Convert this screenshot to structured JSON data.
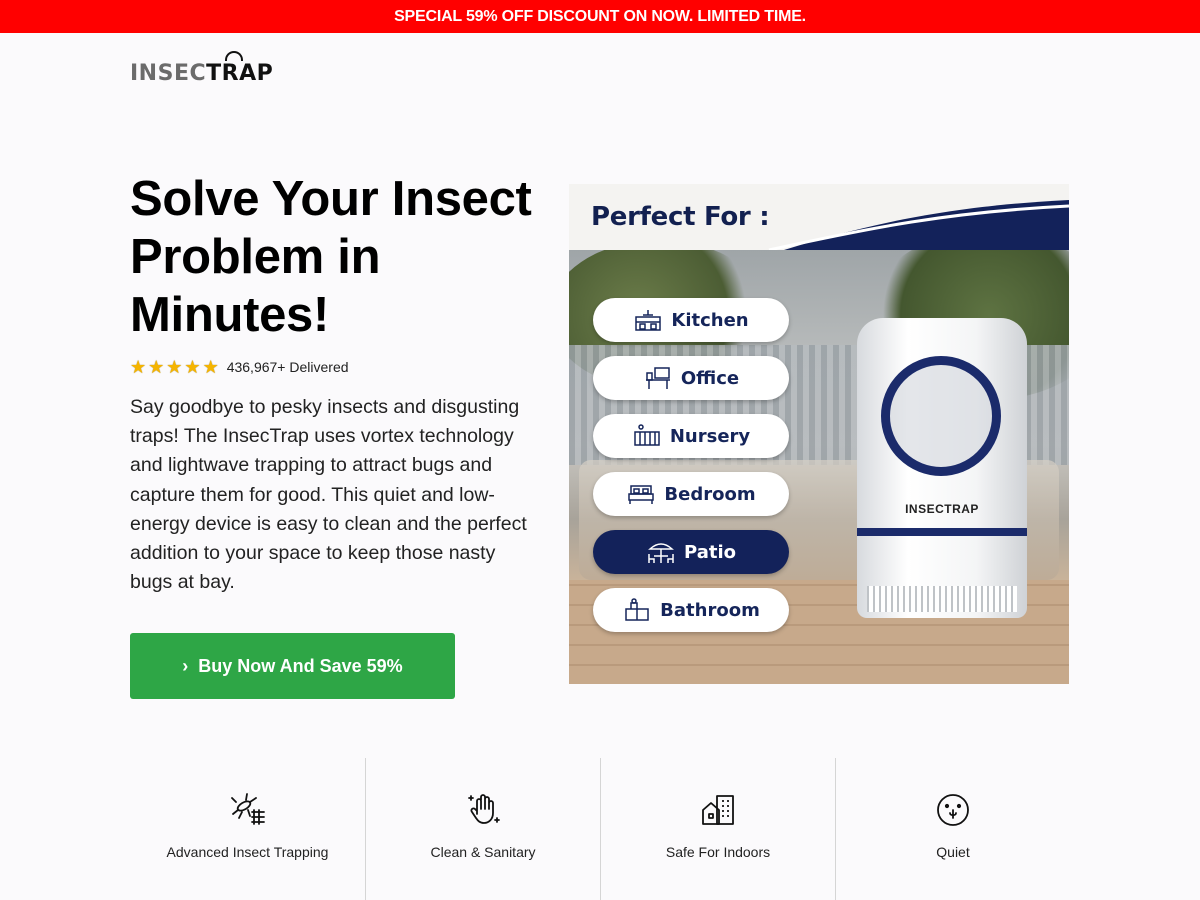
{
  "promo_bar": {
    "text": "SPECIAL 59% OFF DISCOUNT ON NOW. LIMITED TIME."
  },
  "header": {
    "logo_part1": "INSEC",
    "logo_part2": "TRAP"
  },
  "hero": {
    "title": "Solve Your Insect Problem in Minutes!",
    "rating": {
      "stars": 5,
      "text": "436,967+ Delivered"
    },
    "description": "Say goodbye to pesky insects and disgusting traps! The InsecTrap uses vortex technology and lightwave trapping to attract bugs and capture them for good. This quiet and low-energy device is easy to clean and the perfect addition to your space to keep those nasty bugs at bay.",
    "cta_label": "Buy Now And Save 59%",
    "cta_color": "#2ea646"
  },
  "product_image": {
    "heading": "Perfect For :",
    "rooms": [
      {
        "label": "Kitchen",
        "icon": "kitchen-icon",
        "active": false
      },
      {
        "label": "Office",
        "icon": "office-desk-icon",
        "active": false
      },
      {
        "label": "Nursery",
        "icon": "crib-icon",
        "active": false
      },
      {
        "label": "Bedroom",
        "icon": "bed-icon",
        "active": false
      },
      {
        "label": "Patio",
        "icon": "patio-umbrella-icon",
        "active": true
      },
      {
        "label": "Bathroom",
        "icon": "bathroom-sink-icon",
        "active": false
      }
    ],
    "device_brand": "INSECTRAP",
    "accent_color": "#13225a"
  },
  "features": [
    {
      "label": "Advanced Insect Trapping",
      "icon": "mosquito-net-icon"
    },
    {
      "label": "Clean & Sanitary",
      "icon": "clean-hand-icon"
    },
    {
      "label": "Safe For Indoors",
      "icon": "house-building-icon"
    },
    {
      "label": "Quiet",
      "icon": "quiet-face-icon"
    }
  ],
  "colors": {
    "promo_bg": "#ff0000",
    "title": "#000000",
    "navy": "#13225a"
  }
}
